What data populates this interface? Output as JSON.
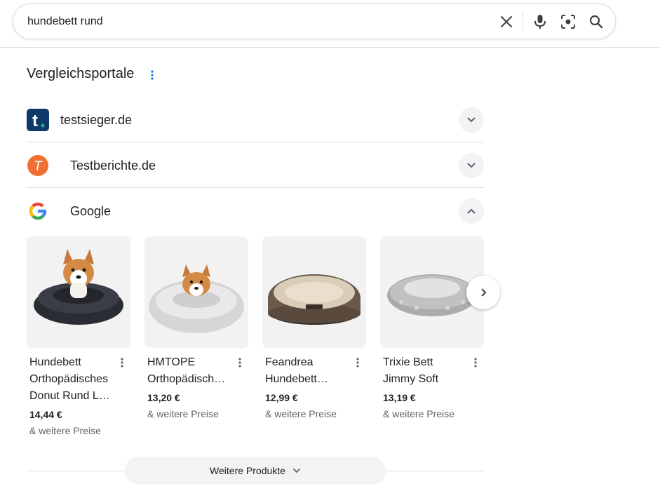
{
  "search": {
    "query": "hundebett rund",
    "icons": [
      "close-icon",
      "microphone-icon",
      "lens-icon",
      "search-icon"
    ]
  },
  "comparison": {
    "title": "Vergleichsportale",
    "providers": [
      {
        "name": "testsieger.de",
        "logo": "testsieger-logo",
        "logo_letter": "t",
        "expanded": false
      },
      {
        "name": "Testberichte.de",
        "logo": "testberichte-logo",
        "logo_letter": "T",
        "expanded": false
      },
      {
        "name": "Google",
        "logo": "google-logo",
        "expanded": true
      }
    ]
  },
  "products": [
    {
      "title_line1": "Hundebett",
      "title_line2": "Orthopädisches",
      "title_line3": "Donut Rund L…",
      "price": "14,44 €",
      "more": "& weitere Preise",
      "image": "dark-grey donut bed with corgi"
    },
    {
      "title_line1": "HMTOPE",
      "title_line2": "Orthopädisch…",
      "price": "13,20 €",
      "more": "& weitere Preise",
      "image": "light-grey fluffy bed with corgi"
    },
    {
      "title_line1": "Feandrea",
      "title_line2": "Hundebett…",
      "price": "12,99 €",
      "more": "& weitere Preise",
      "image": "brown round bed with beige cushion"
    },
    {
      "title_line1": "Trixie Bett",
      "title_line2": "Jimmy Soft",
      "price": "13,19 €",
      "more": "& weitere Preise",
      "image": "grey oval bed with paw prints"
    }
  ],
  "more_products": {
    "label": "Weitere Produkte"
  },
  "colors": {
    "testsieger_bg": "#0d3a6b",
    "testsieger_dot": "#2bb673",
    "testberichte_bg": "#f07033",
    "chip_bg": "#f1f3f4",
    "divider": "#dadce0",
    "kebab_blue": "#1a73e8"
  }
}
